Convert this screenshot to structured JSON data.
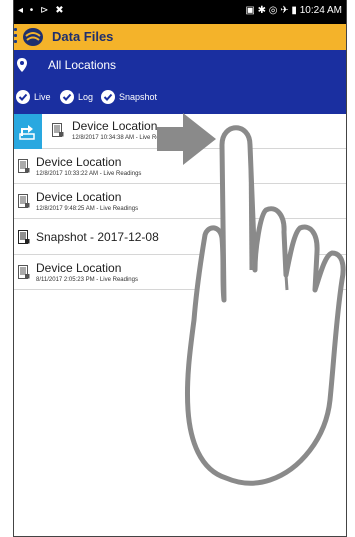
{
  "statusbar": {
    "left_icons": "◂ • ⊳ ✖",
    "right_icons": "▣ ✱ ◎ ✈ ▮",
    "time": "10:24 AM"
  },
  "appbar": {
    "title": "Data Files"
  },
  "location": {
    "label": "All Locations"
  },
  "filters": [
    {
      "label": "Live",
      "checked": true
    },
    {
      "label": "Log",
      "checked": true
    },
    {
      "label": "Snapshot",
      "checked": true
    }
  ],
  "files": [
    {
      "title": "Device Location",
      "subtitle": "12/8/2017 10:34:38 AM - Live Readings",
      "selected": true
    },
    {
      "title": "Device Location",
      "subtitle": "12/8/2017 10:33:22 AM - Live Readings"
    },
    {
      "title": "Device Location",
      "subtitle": "12/8/2017 9:48:25 AM - Live Readings"
    },
    {
      "title": "Snapshot - 2017-12-08",
      "subtitle": ""
    },
    {
      "title": "Device Location",
      "subtitle": "8/11/2017 2:05:23 PM - Live Readings"
    }
  ],
  "colors": {
    "appbar": "#f4b32a",
    "header_blue": "#1a2fa0",
    "share_blue": "#29a8e0",
    "gesture_arrow": "#8a8a8a"
  },
  "icons": [
    "menu-icon",
    "logo-icon",
    "location-pin-icon",
    "check-circle-icon",
    "share-icon",
    "document-icon",
    "swipe-arrow-icon",
    "hand-gesture-icon"
  ]
}
